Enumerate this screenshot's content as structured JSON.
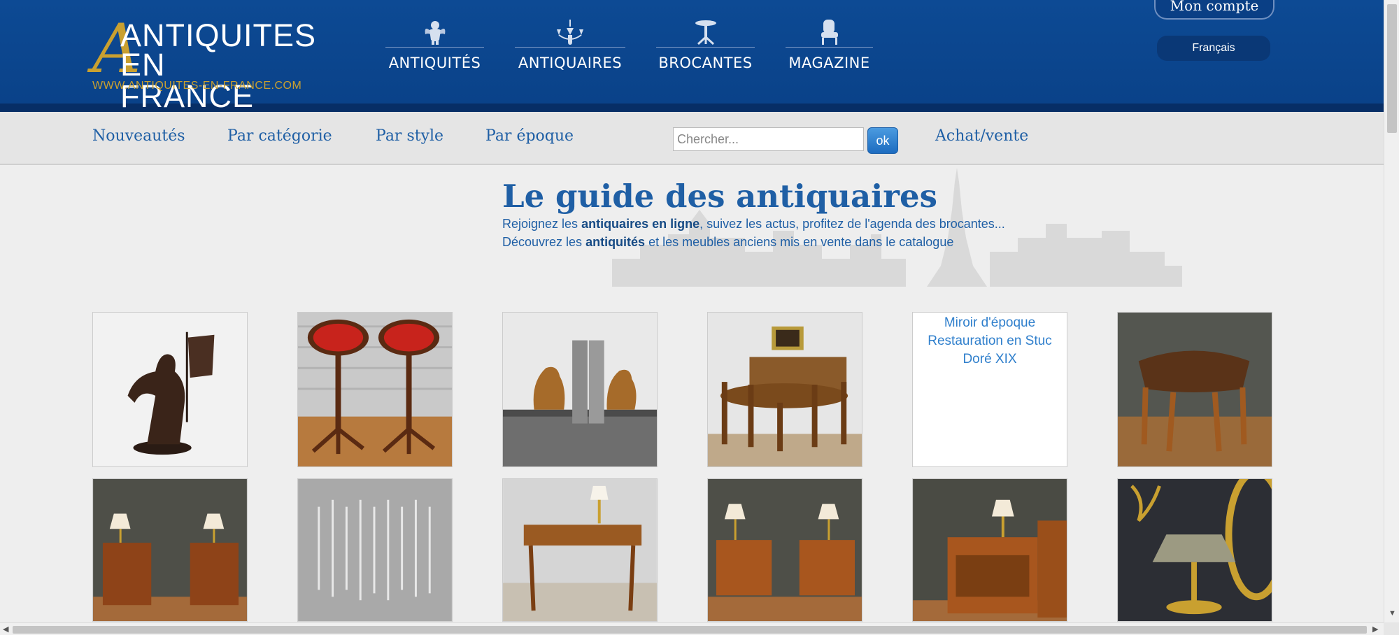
{
  "header": {
    "logo": {
      "line1": "ANTIQUITES",
      "line2": "EN FRANCE",
      "url": "WWW.ANTIQUITES-EN-FRANCE.COM"
    },
    "nav": [
      {
        "label": "ANTIQUITÉS",
        "icon": "cherub-icon"
      },
      {
        "label": "ANTIQUAIRES",
        "icon": "chandelier-icon"
      },
      {
        "label": "BROCANTES",
        "icon": "gueridon-table-icon"
      },
      {
        "label": "MAGAZINE",
        "icon": "armchair-icon"
      }
    ],
    "account_label": "Mon compte",
    "language": "Français"
  },
  "subnav": {
    "items": [
      "Nouveautés",
      "Par catégorie",
      "Par style",
      "Par époque"
    ],
    "search_placeholder": "Chercher...",
    "search_button": "ok",
    "buy_sell": "Achat/vente"
  },
  "hero": {
    "title": "Le guide des antiquaires",
    "line1": {
      "pre": "Rejoignez les ",
      "bold": "antiquaires en ligne",
      "post": ", suivez les actus, profitez de l'agenda des brocantes..."
    },
    "line2": {
      "pre": "Découvrez les ",
      "bold": "antiquités",
      "post": " et les meubles anciens mis en vente dans le catalogue"
    }
  },
  "catalog": {
    "row1": [
      {
        "subject": "bronze-statue-with-banner"
      },
      {
        "subject": "pair-of-pedestal-tables"
      },
      {
        "subject": "bird-bookends-on-marble"
      },
      {
        "subject": "dining-table-and-chairs"
      },
      {
        "subject": "broken-image",
        "alt": "Miroir d'époque Restauration en Stuc Doré XIX"
      },
      {
        "subject": "leather-stool"
      }
    ],
    "row2": [
      {
        "subject": "pair-of-bedside-tables"
      },
      {
        "subject": "crystal-flutes"
      },
      {
        "subject": "writing-desk-with-lamp"
      },
      {
        "subject": "pair-of-nightstands"
      },
      {
        "subject": "marquetry-cabinet-with-lamp"
      },
      {
        "subject": "bouillotte-lamp-and-mirror"
      }
    ]
  },
  "colors": {
    "header_blue": "#0d4a94",
    "link_blue": "#1f5fa5",
    "gold": "#c9a030"
  }
}
